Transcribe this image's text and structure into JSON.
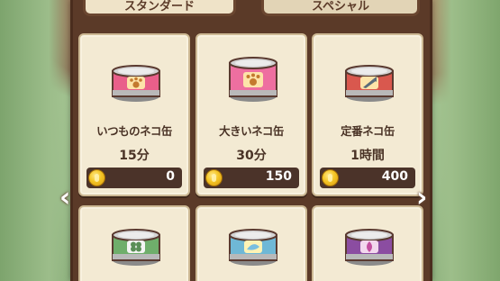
{
  "tabs": {
    "standard": "スタンダード",
    "special": "スペシャル"
  },
  "items": [
    {
      "name": "いつものネコ缶",
      "time": "15分",
      "price": "0",
      "can_color": "#e95f8a"
    },
    {
      "name": "大きいネコ缶",
      "time": "30分",
      "price": "150",
      "can_color": "#ee6fa0"
    },
    {
      "name": "定番ネコ缶",
      "time": "1時間",
      "price": "400",
      "can_color": "#d9584e"
    },
    {
      "can_color": "#6fae6b"
    },
    {
      "can_color": "#6fb8d6"
    },
    {
      "can_color": "#8b4da1"
    }
  ],
  "icons": {
    "coin": "coin-icon",
    "prev": "chevron-left-icon",
    "next": "chevron-right-icon"
  }
}
